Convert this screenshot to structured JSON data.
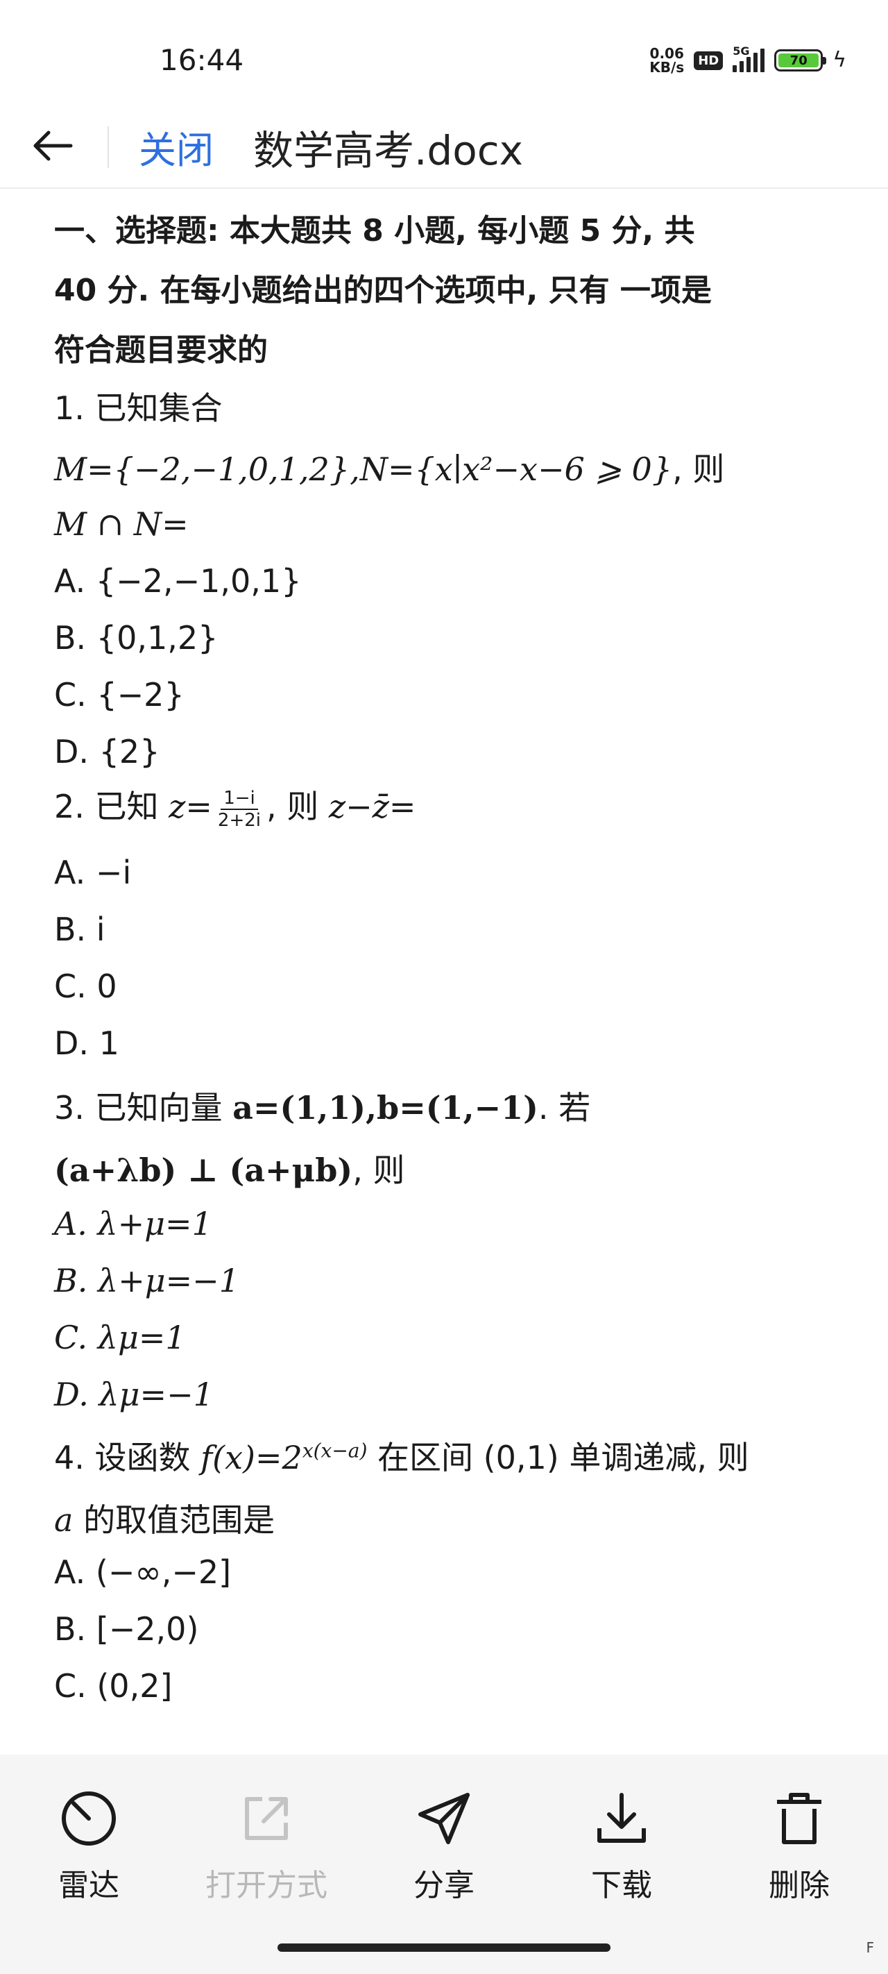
{
  "status": {
    "time": "16:44",
    "net_speed_value": "0.06",
    "net_speed_unit": "KB/s",
    "hd": "HD",
    "network": "5G",
    "battery": "70"
  },
  "app_bar": {
    "close_label": "关闭",
    "title": "数学高考.docx"
  },
  "document": {
    "section_title_1": "一、选择题: 本大题共 8 小题, 每小题 5 分, 共",
    "section_title_2": "40 分. 在每小题给出的四个选项中, 只有 一项是",
    "section_title_3": "符合题目要求的",
    "q1_stem_1": "1. 已知集合",
    "q1_math": "M={−2,−1,0,1,2},N={x∣x²−x−6 ⩾ 0}",
    "q1_then": ", 则",
    "q1_stem_3": "M ∩ N=",
    "q1_a": "A. {−2,−1,0,1}",
    "q1_b": "B. {0,1,2}",
    "q1_c": "C. {−2}",
    "q1_d": "D. {2}",
    "q2_prefix": "2. 已知",
    "q2_z": "z=",
    "q2_num": "1−i",
    "q2_den": "2+2i",
    "q2_mid": ", 则",
    "q2_expr": "z−z̄=",
    "q2_a": "A. −i",
    "q2_b": "B. i",
    "q2_c": "C. 0",
    "q2_d": "D. 1",
    "q3_prefix": "3. 已知向量",
    "q3_math": "a=(1,1),b=(1,−1)",
    "q3_suffix": ". 若",
    "q3_math2": "(a+λb) ⊥ (a+μb)",
    "q3_suffix2": ", 则",
    "q3_a": "A. λ+μ=1",
    "q3_b": "B. λ+μ=−1",
    "q3_c": "C. λμ=1",
    "q3_d": "D. λμ=−1",
    "q4_prefix": "4. 设函数",
    "q4_fx": "f(x)=2",
    "q4_exp": "x(x−a)",
    "q4_suffix": "在区间 (0,1) 单调递减, 则",
    "q4_a_var": "a",
    "q4_line2": "的取值范围是",
    "q4_a": "A. (−∞,−2]",
    "q4_b": "B. [−2,0)",
    "q4_c": "C. (0,2]"
  },
  "bottom_bar": {
    "items": [
      {
        "label": "雷达",
        "icon": "radar-icon",
        "enabled": true
      },
      {
        "label": "打开方式",
        "icon": "open-external-icon",
        "enabled": false
      },
      {
        "label": "分享",
        "icon": "share-icon",
        "enabled": true
      },
      {
        "label": "下载",
        "icon": "download-icon",
        "enabled": true
      },
      {
        "label": "删除",
        "icon": "delete-icon",
        "enabled": true
      }
    ],
    "corner_mark": "F"
  }
}
